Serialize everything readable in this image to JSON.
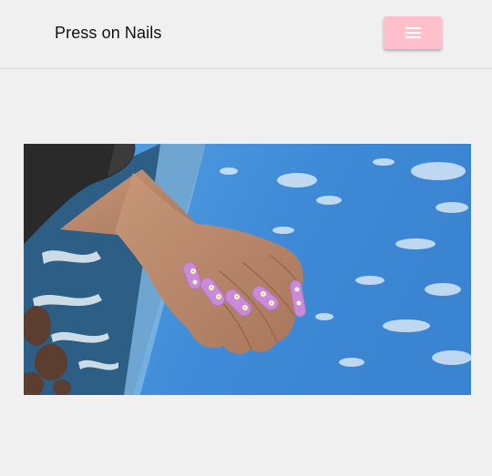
{
  "navbar": {
    "brand": "Press on Nails",
    "menu_icon": "hamburger-menu-icon",
    "menu_button_color": "#ffc0cb"
  },
  "hero": {
    "image": "photo-hand-with-lilac-daisy-press-on-nails-against-sky-and-ocean"
  },
  "colors": {
    "background": "#f0f0f0",
    "accent": "#ffc0cb",
    "nail_color": "#c98ad8",
    "sky": "#3f8fd8"
  }
}
